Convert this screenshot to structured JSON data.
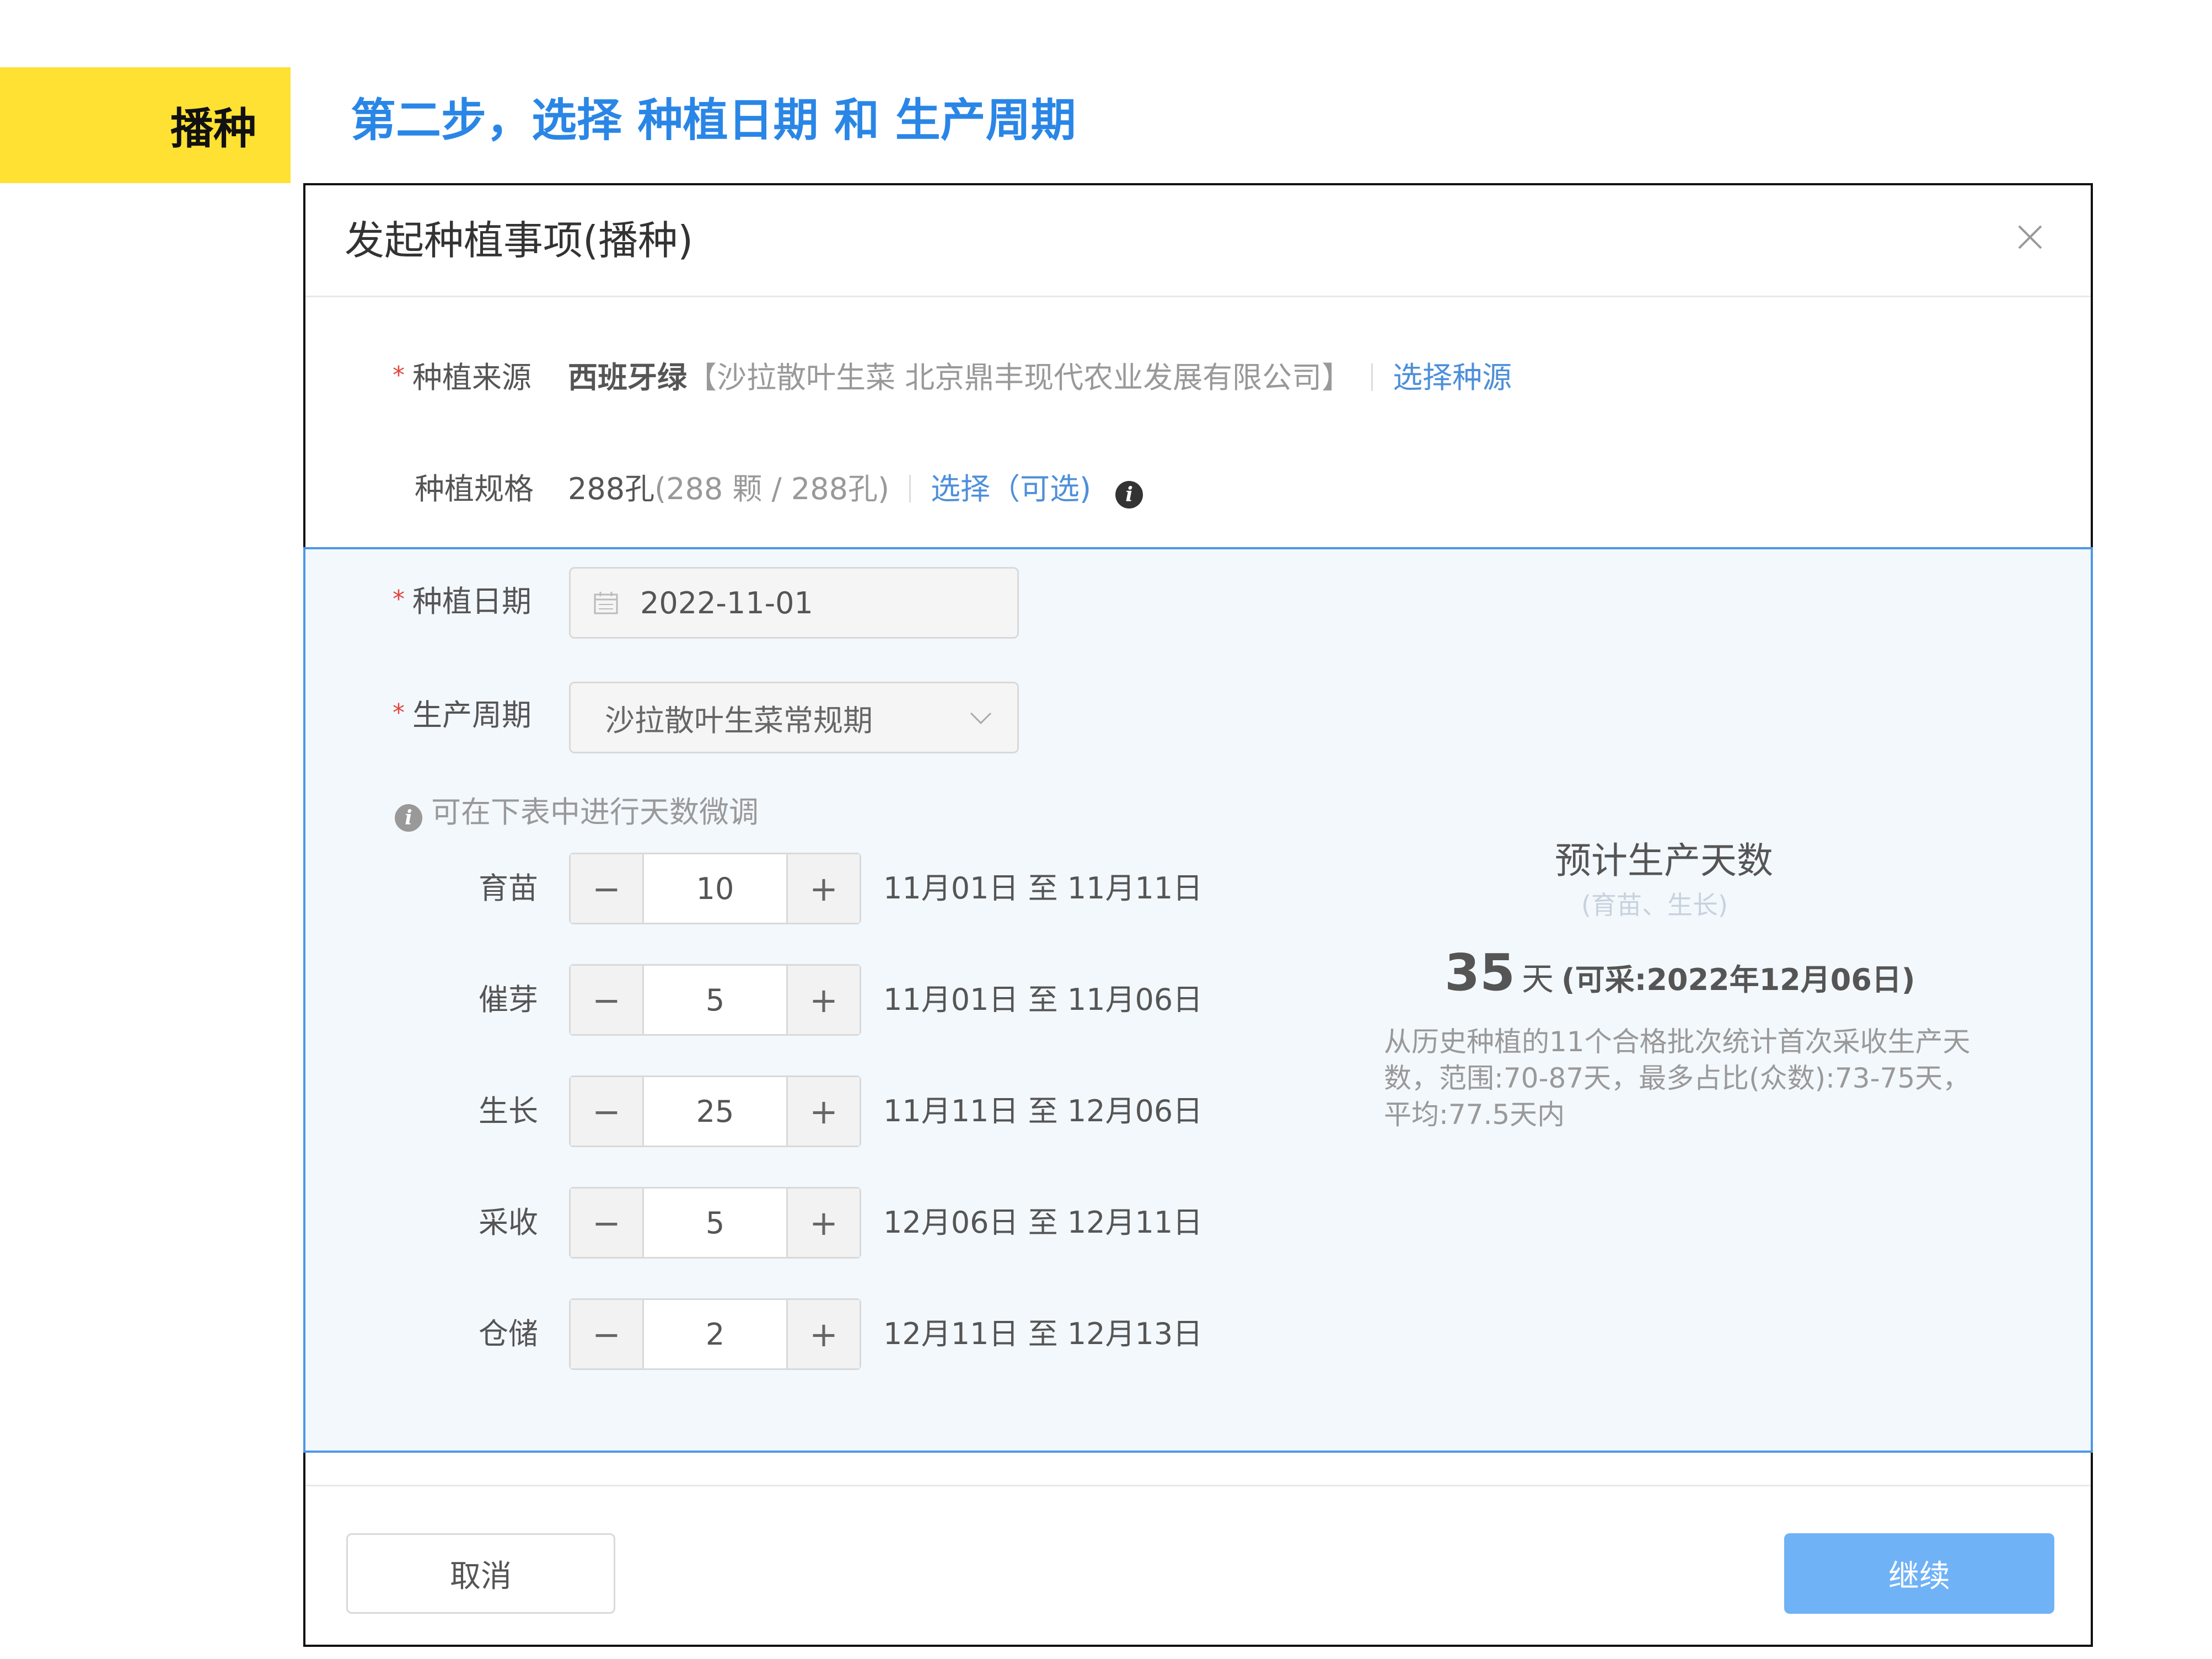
{
  "banner": {
    "tag": "播种",
    "step_title": "第二步，选择 种植日期 和 生产周期"
  },
  "dialog": {
    "title": "发起种植事项(播种)",
    "close_icon": "close-icon",
    "source": {
      "label": "种植来源",
      "variety": "西班牙绿",
      "detail": "【沙拉散叶生菜 北京鼎丰现代农业发展有限公司】",
      "action": "选择种源"
    },
    "spec": {
      "label": "种植规格",
      "value": "288孔",
      "detail": "(288 颗 / 288孔)",
      "action": "选择（可选)",
      "info_icon": "info-icon"
    },
    "planting_date": {
      "label": "种植日期",
      "value": "2022-11-01",
      "icon": "calendar-icon"
    },
    "cycle": {
      "label": "生产周期",
      "value": "沙拉散叶生菜常规期",
      "icon": "chevron-down-icon"
    },
    "hint": "可在下表中进行天数微调",
    "stages": [
      {
        "name": "育苗",
        "days": "10",
        "range": "11月01日 至 11月11日"
      },
      {
        "name": "催芽",
        "days": "5",
        "range": "11月01日 至 11月06日"
      },
      {
        "name": "生长",
        "days": "25",
        "range": "11月11日 至 12月06日"
      },
      {
        "name": "采收",
        "days": "5",
        "range": "12月06日 至 12月11日"
      },
      {
        "name": "仓储",
        "days": "2",
        "range": "12月11日 至 12月13日"
      }
    ],
    "stepper_minus": "−",
    "stepper_plus": "+",
    "estimate": {
      "title": "预计生产天数",
      "subtitle": "(育苗、生长)",
      "days": "35",
      "unit": "天",
      "harvest": "(可采:2022年12月06日)",
      "description": "从历史种植的11个合格批次统计首次采收生产天数，范围:70-87天，最多占比(众数):73-75天，平均:77.5天内"
    },
    "footer": {
      "cancel": "取消",
      "continue": "继续"
    }
  }
}
